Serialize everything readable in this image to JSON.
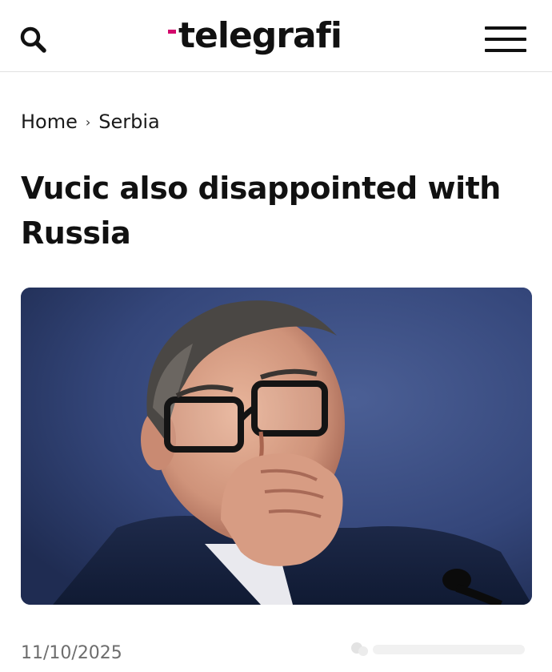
{
  "header": {
    "logo_text": "telegrafi",
    "colors": {
      "logo_accent": "#d3086c",
      "text": "#111111",
      "divider": "#e1e1e1"
    },
    "icons": {
      "search": "search-icon",
      "menu": "hamburger-menu-icon"
    }
  },
  "breadcrumb": {
    "items": [
      "Home",
      "Serbia"
    ],
    "separator": "›"
  },
  "article": {
    "title": "Vucic also disappointed with Russia",
    "date": "11/10/2025",
    "image": {
      "description_icon": "photo-man-with-glasses-hand-on-chin"
    }
  }
}
